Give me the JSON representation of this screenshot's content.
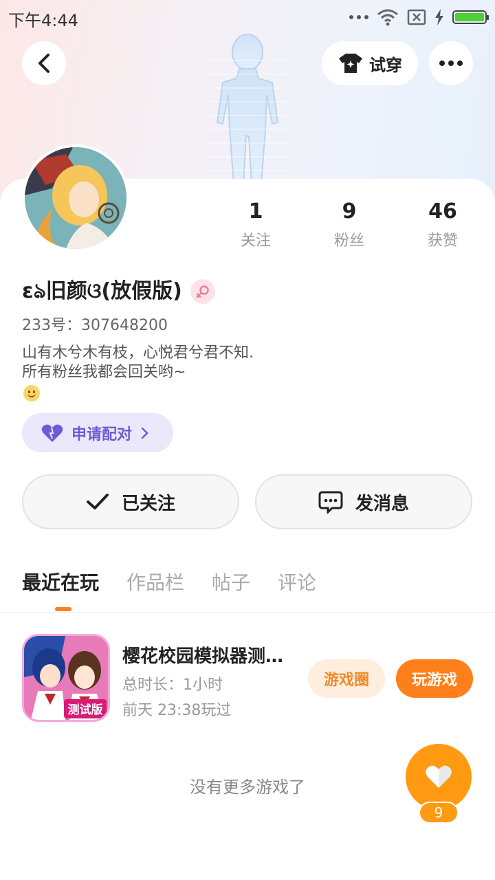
{
  "status_bar": {
    "time": "下午4:44"
  },
  "header": {
    "try_on_label": "试穿"
  },
  "profile": {
    "stats": [
      {
        "value": "1",
        "label": "关注"
      },
      {
        "value": "9",
        "label": "粉丝"
      },
      {
        "value": "46",
        "label": "获赞"
      }
    ],
    "nickname": "ɛঌ旧颜ଓ(放假版)",
    "uid": "233号：307648200",
    "bio_line1": "山有木兮木有枝，心悦君兮君不知.",
    "bio_line2": "所有粉丝我都会回关哟~",
    "pair_label": "申请配对"
  },
  "actions": {
    "follow_label": "已关注",
    "message_label": "发消息"
  },
  "tabs": [
    "最近在玩",
    "作品栏",
    "帖子",
    "评论"
  ],
  "active_tab": "最近在玩",
  "games": [
    {
      "name": "樱花校园模拟器测试版",
      "duration": "总时长：1小时",
      "last_played": "前天 23:38玩过",
      "icon_badge": "测试版",
      "circle_label": "游戏圈",
      "play_label": "玩游戏"
    }
  ],
  "footer": {
    "no_more": "没有更多游戏了"
  },
  "like": {
    "count": "9"
  },
  "colors": {
    "accent": "#ff7f1a",
    "pair_purple": "#6b5dd3",
    "like_orange": "#ff9a12"
  }
}
